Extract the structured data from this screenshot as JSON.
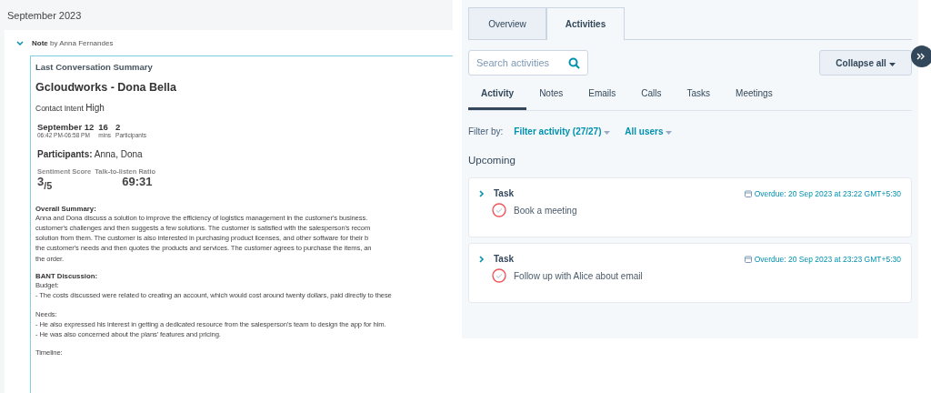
{
  "timeline": {
    "month": "September 2023",
    "note": {
      "expanded": true,
      "type": "Note",
      "author": "by Anna Fernandes",
      "heading": "Last Conversation Summary",
      "title": "Gcloudworks - Dona Bella",
      "intent_label": "Contact Intent",
      "intent": "High",
      "stats": [
        {
          "value": "September 12",
          "label": "06:42 PM-06:58 PM"
        },
        {
          "value": "16",
          "label": "mins"
        },
        {
          "value": "2",
          "label": "Participants"
        }
      ],
      "participants_label": "Participants:",
      "participants": "Anna, Dona",
      "metrics": [
        {
          "label": "Sentiment Score",
          "value": "3$_{/5}$"
        },
        {
          "label": "Talk-to-listen Ratio",
          "value": "69:31"
        }
      ],
      "sections": [
        {
          "heading": "Overall Summary:",
          "lines": [
            "Anna and Dona discuss a solution to improve the efficiency of logistics management in the customer's business.",
            "customer's challenges and then suggests a few solutions. The customer is satisfied with the salesperson's recom",
            "solution from them. The customer is also interested in purchasing product licenses, and other software for their b",
            "the customer's needs and then quotes the products and services. The customer agrees to purchase the items, an",
            "the order."
          ]
        },
        {
          "heading": "BANT Discussion:"
        }
      ],
      "subsections": [
        {
          "label": "Budget:",
          "lines": [
            "- The costs discussed were related to creating an account, which would cost around twenty dollars, paid directly to these"
          ]
        },
        {
          "label": "Needs:",
          "lines": [
            "- He also expressed his interest in getting a dedicated resource from the salesperson's team to design the app for him.",
            "- He was also concerned about the plans' features and pricing."
          ]
        },
        {
          "label": "Timeline:"
        }
      ]
    }
  },
  "panel": {
    "tabs": [
      {
        "label": "Overview",
        "selected": false
      },
      {
        "label": "Activities",
        "selected": true
      }
    ],
    "search": {
      "placeholder": "Search activities"
    },
    "collapse_button": "Collapse all",
    "subtabs": [
      {
        "label": "Activity",
        "selected": true
      },
      {
        "label": "Notes",
        "selected": false
      },
      {
        "label": "Emails",
        "selected": false
      },
      {
        "label": "Calls",
        "selected": false
      },
      {
        "label": "Tasks",
        "selected": false
      },
      {
        "label": "Meetings",
        "selected": false
      }
    ],
    "filter_label": "Filter by:",
    "filters": [
      "Filter activity (27/27)",
      "All users"
    ],
    "section": "Upcoming",
    "tasks": [
      {
        "type": "Task",
        "due": "Overdue: 20 Sep 2023 at 23:22 GMT+5:30",
        "title": "Book a meeting",
        "completed": false
      },
      {
        "type": "Task",
        "due": "Overdue: 20 Sep 2023 at 23:23 GMT+5:30",
        "title": "Follow up with Alice about email",
        "completed": false
      }
    ]
  }
}
